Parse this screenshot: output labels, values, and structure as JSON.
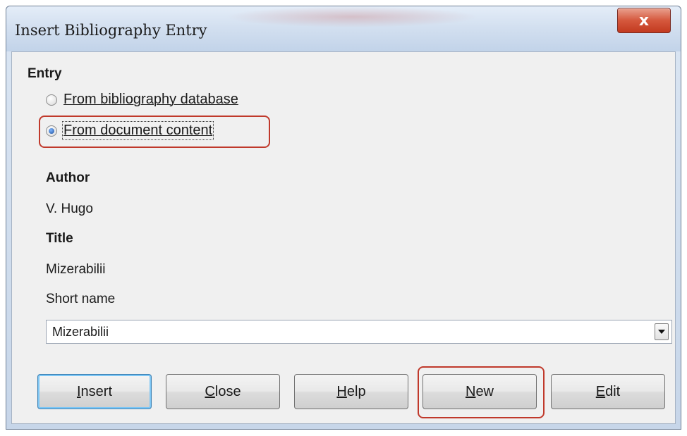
{
  "window": {
    "title": "Insert Bibliography Entry",
    "close_glyph": "x"
  },
  "entry": {
    "section_label": "Entry",
    "options": [
      {
        "label": "From bibliography database",
        "selected": false
      },
      {
        "label": "From document content",
        "selected": true
      }
    ]
  },
  "fields": {
    "author_label": "Author",
    "author_value": "V. Hugo",
    "title_label": "Title",
    "title_value": "Mizerabilii",
    "short_name_label": "Short name",
    "short_name_value": "Mizerabilii"
  },
  "buttons": {
    "insert": "Insert",
    "close": "Close",
    "help": "Help",
    "new": "New",
    "edit": "Edit"
  },
  "colors": {
    "highlight": "#c0392b",
    "close_button": "#c23a1f",
    "dialog_background": "#f0f0f0"
  }
}
